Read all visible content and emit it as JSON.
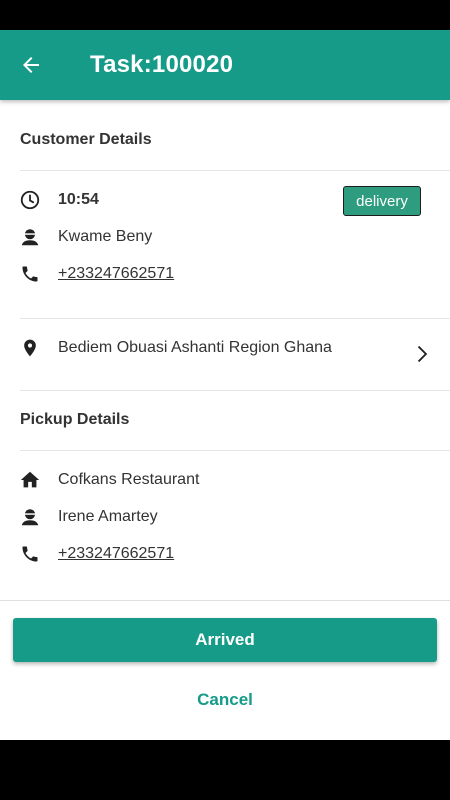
{
  "app_bar": {
    "title": "Task:100020",
    "back_icon": "arrow-back-icon",
    "background": "#169b88"
  },
  "customer": {
    "section_title": "Customer Details",
    "time": "10:54",
    "type_badge": "delivery",
    "name": "Kwame Beny",
    "phone": "+233247662571",
    "address": "Bediem Obuasi Ashanti Region Ghana"
  },
  "pickup": {
    "section_title": "Pickup Details",
    "place": "Cofkans Restaurant",
    "name": "Irene Amartey",
    "phone": "+233247662571"
  },
  "actions": {
    "arrived_label": "Arrived",
    "cancel_label": "Cancel"
  },
  "colors": {
    "accent": "#169b88",
    "badge": "#2e9c7f"
  }
}
